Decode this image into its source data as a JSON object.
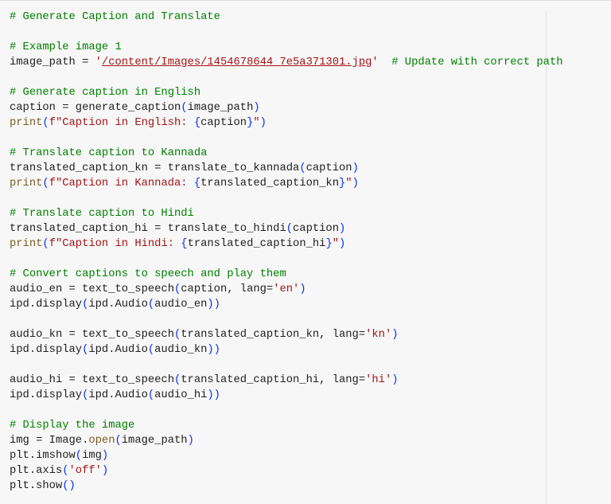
{
  "code_lines": [
    [
      {
        "t": "# Generate Caption and Translate",
        "c": "cm"
      }
    ],
    [],
    [
      {
        "t": "# Example image 1",
        "c": "cm"
      }
    ],
    [
      {
        "t": "image_path = "
      },
      {
        "t": "'",
        "c": "str"
      },
      {
        "t": "/content/Images/1454678644_7e5a371301.jpg",
        "c": "str link"
      },
      {
        "t": "'",
        "c": "str"
      },
      {
        "t": "  "
      },
      {
        "t": "# Update with correct path",
        "c": "cm"
      }
    ],
    [],
    [
      {
        "t": "# Generate caption in English",
        "c": "cm"
      }
    ],
    [
      {
        "t": "caption = generate_caption"
      },
      {
        "t": "(",
        "c": "br"
      },
      {
        "t": "image_path"
      },
      {
        "t": ")",
        "c": "br"
      }
    ],
    [
      {
        "t": "print",
        "c": "fn"
      },
      {
        "t": "(",
        "c": "br"
      },
      {
        "t": "f\"Caption in English: ",
        "c": "str"
      },
      {
        "t": "{",
        "c": "br"
      },
      {
        "t": "caption"
      },
      {
        "t": "}",
        "c": "br"
      },
      {
        "t": "\"",
        "c": "str"
      },
      {
        "t": ")",
        "c": "br"
      }
    ],
    [],
    [
      {
        "t": "# Translate caption to Kannada",
        "c": "cm"
      }
    ],
    [
      {
        "t": "translated_caption_kn = translate_to_kannada"
      },
      {
        "t": "(",
        "c": "br"
      },
      {
        "t": "caption"
      },
      {
        "t": ")",
        "c": "br"
      }
    ],
    [
      {
        "t": "print",
        "c": "fn"
      },
      {
        "t": "(",
        "c": "br"
      },
      {
        "t": "f\"Caption in Kannada: ",
        "c": "str"
      },
      {
        "t": "{",
        "c": "br"
      },
      {
        "t": "translated_caption_kn"
      },
      {
        "t": "}",
        "c": "br"
      },
      {
        "t": "\"",
        "c": "str"
      },
      {
        "t": ")",
        "c": "br"
      }
    ],
    [],
    [
      {
        "t": "# Translate caption to Hindi",
        "c": "cm"
      }
    ],
    [
      {
        "t": "translated_caption_hi = translate_to_hindi"
      },
      {
        "t": "(",
        "c": "br"
      },
      {
        "t": "caption"
      },
      {
        "t": ")",
        "c": "br"
      }
    ],
    [
      {
        "t": "print",
        "c": "fn"
      },
      {
        "t": "(",
        "c": "br"
      },
      {
        "t": "f\"Caption in Hindi: ",
        "c": "str"
      },
      {
        "t": "{",
        "c": "br"
      },
      {
        "t": "translated_caption_hi"
      },
      {
        "t": "}",
        "c": "br"
      },
      {
        "t": "\"",
        "c": "str"
      },
      {
        "t": ")",
        "c": "br"
      }
    ],
    [],
    [
      {
        "t": "# Convert captions to speech and play them",
        "c": "cm"
      }
    ],
    [
      {
        "t": "audio_en = text_to_speech"
      },
      {
        "t": "(",
        "c": "br"
      },
      {
        "t": "caption, lang="
      },
      {
        "t": "'en'",
        "c": "str"
      },
      {
        "t": ")",
        "c": "br"
      }
    ],
    [
      {
        "t": "ipd.display"
      },
      {
        "t": "(",
        "c": "br"
      },
      {
        "t": "ipd.Audio"
      },
      {
        "t": "(",
        "c": "br"
      },
      {
        "t": "audio_en"
      },
      {
        "t": "))",
        "c": "br"
      }
    ],
    [],
    [
      {
        "t": "audio_kn = text_to_speech"
      },
      {
        "t": "(",
        "c": "br"
      },
      {
        "t": "translated_caption_kn, lang="
      },
      {
        "t": "'kn'",
        "c": "str"
      },
      {
        "t": ")",
        "c": "br"
      }
    ],
    [
      {
        "t": "ipd.display"
      },
      {
        "t": "(",
        "c": "br"
      },
      {
        "t": "ipd.Audio"
      },
      {
        "t": "(",
        "c": "br"
      },
      {
        "t": "audio_kn"
      },
      {
        "t": "))",
        "c": "br"
      }
    ],
    [],
    [
      {
        "t": "audio_hi = text_to_speech"
      },
      {
        "t": "(",
        "c": "br"
      },
      {
        "t": "translated_caption_hi, lang="
      },
      {
        "t": "'hi'",
        "c": "str"
      },
      {
        "t": ")",
        "c": "br"
      }
    ],
    [
      {
        "t": "ipd.display"
      },
      {
        "t": "(",
        "c": "br"
      },
      {
        "t": "ipd.Audio"
      },
      {
        "t": "(",
        "c": "br"
      },
      {
        "t": "audio_hi"
      },
      {
        "t": "))",
        "c": "br"
      }
    ],
    [],
    [
      {
        "t": "# Display the image",
        "c": "cm"
      }
    ],
    [
      {
        "t": "img = Image."
      },
      {
        "t": "open",
        "c": "fn"
      },
      {
        "t": "(",
        "c": "br"
      },
      {
        "t": "image_path"
      },
      {
        "t": ")",
        "c": "br"
      }
    ],
    [
      {
        "t": "plt.imshow"
      },
      {
        "t": "(",
        "c": "br"
      },
      {
        "t": "img"
      },
      {
        "t": ")",
        "c": "br"
      }
    ],
    [
      {
        "t": "plt.axis"
      },
      {
        "t": "(",
        "c": "br"
      },
      {
        "t": "'off'",
        "c": "str"
      },
      {
        "t": ")",
        "c": "br"
      }
    ],
    [
      {
        "t": "plt.show"
      },
      {
        "t": "()",
        "c": "br"
      }
    ]
  ],
  "colors": {
    "background": "#f7f7f7",
    "comment": "#008000",
    "string": "#a31515",
    "function": "#795e26",
    "bracket": "#0431fa",
    "text": "#212121"
  }
}
